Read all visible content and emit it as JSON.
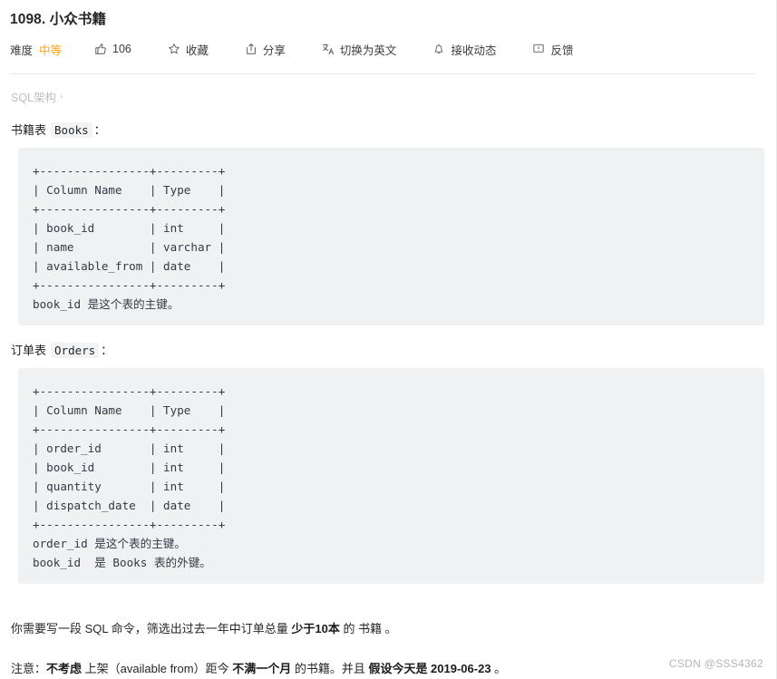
{
  "problem": {
    "title": "1098. 小众书籍"
  },
  "toolbar": {
    "difficulty_label": "难度",
    "difficulty_value": "中等",
    "difficulty_color": "#ffa116",
    "items": [
      {
        "icon": "thumbs-up-icon",
        "label": "106"
      },
      {
        "icon": "star-icon",
        "label": "收藏"
      },
      {
        "icon": "share-icon",
        "label": "分享"
      },
      {
        "icon": "translate-icon",
        "label": "切换为英文"
      },
      {
        "icon": "bell-icon",
        "label": "接收动态"
      },
      {
        "icon": "feedback-icon",
        "label": "反馈"
      }
    ]
  },
  "breadcrumb": {
    "label": "SQL架构",
    "chevron": "›"
  },
  "sections": [
    {
      "zh_label": "书籍表",
      "code_name": "Books",
      "colon": "：",
      "code": "+----------------+---------+\n| Column Name    | Type    |\n+----------------+---------+\n| book_id        | int     |\n| name           | varchar |\n| available_from | date    |\n+----------------+---------+\nbook_id 是这个表的主键。"
    },
    {
      "zh_label": "订单表",
      "code_name": "Orders",
      "colon": "：",
      "code": "+----------------+---------+\n| Column Name    | Type    |\n+----------------+---------+\n| order_id       | int     |\n| book_id        | int     |\n| quantity       | int     |\n| dispatch_date  | date    |\n+----------------+---------+\norder_id 是这个表的主键。\nbook_id  是 Books 表的外键。"
    }
  ],
  "description": {
    "p1_a": "你需要写一段 SQL 命令，筛选出过去一年中订单总量 ",
    "p1_bold": "少于10本",
    "p1_b": " 的 书籍 。",
    "p2_a": "注意：",
    "p2_bold1": "不考虑",
    "p2_b": " 上架（available from）距今 ",
    "p2_bold2": "不满一个月",
    "p2_c": " 的书籍。并且 ",
    "p2_bold3": "假设今天是 2019-06-23",
    "p2_d": " 。"
  },
  "watermark": {
    "text": "CSDN @SSS4362"
  }
}
